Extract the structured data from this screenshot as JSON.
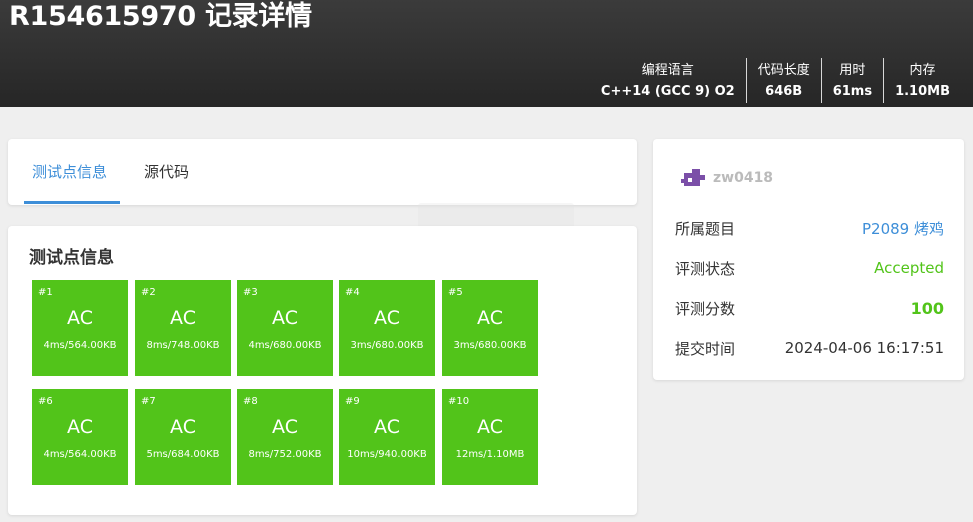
{
  "header": {
    "title": "R154615970 记录详情",
    "stats": [
      {
        "label": "编程语言",
        "value": "C++14 (GCC 9) O2"
      },
      {
        "label": "代码长度",
        "value": "646B"
      },
      {
        "label": "用时",
        "value": "61ms"
      },
      {
        "label": "内存",
        "value": "1.10MB"
      }
    ]
  },
  "tabs": [
    {
      "label": "测试点信息",
      "active": true
    },
    {
      "label": "源代码",
      "active": false
    }
  ],
  "cases_section": {
    "title": "测试点信息",
    "cases": [
      {
        "num": "#1",
        "result": "AC",
        "info": "4ms/564.00KB"
      },
      {
        "num": "#2",
        "result": "AC",
        "info": "8ms/748.00KB"
      },
      {
        "num": "#3",
        "result": "AC",
        "info": "4ms/680.00KB"
      },
      {
        "num": "#4",
        "result": "AC",
        "info": "3ms/680.00KB"
      },
      {
        "num": "#5",
        "result": "AC",
        "info": "3ms/680.00KB"
      },
      {
        "num": "#6",
        "result": "AC",
        "info": "4ms/564.00KB"
      },
      {
        "num": "#7",
        "result": "AC",
        "info": "5ms/684.00KB"
      },
      {
        "num": "#8",
        "result": "AC",
        "info": "8ms/752.00KB"
      },
      {
        "num": "#9",
        "result": "AC",
        "info": "10ms/940.00KB"
      },
      {
        "num": "#10",
        "result": "AC",
        "info": "12ms/1.10MB"
      }
    ]
  },
  "sidebar": {
    "username": "zw0418",
    "rows": [
      {
        "key": "所属题目",
        "value": "P2089 烤鸡"
      },
      {
        "key": "评测状态",
        "value": "Accepted"
      },
      {
        "key": "评测分数",
        "value": "100"
      },
      {
        "key": "提交时间",
        "value": "2024-04-06 16:17:51"
      }
    ]
  },
  "colors": {
    "accent": "#3d8ed8",
    "accepted": "#52c41a",
    "header_bg": "#2f2f2f",
    "username": "#bbbbbb",
    "avatar": "#7b4fa8"
  }
}
